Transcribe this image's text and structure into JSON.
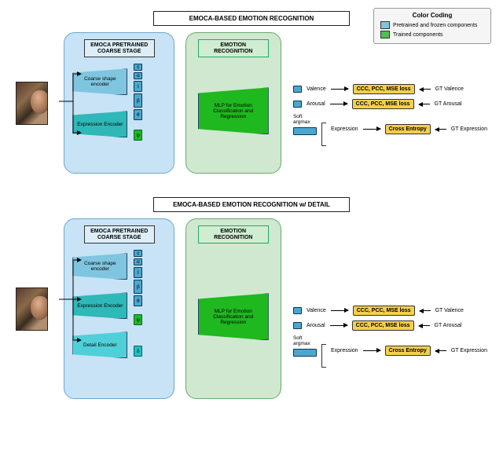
{
  "legend": {
    "title": "Color Coding",
    "pretrained": "Pretrained and frozen components",
    "trained": "Trained components"
  },
  "diagrams": [
    {
      "title": "EMOCA-BASED EMOTION RECOGNITION",
      "coarse_stage_title": "EMOCA PRETRAINED COARSE STAGE",
      "emotion_stage_title": "EMOTION RECOGNITION",
      "encoders": {
        "coarse": "Coarse shape encoder",
        "expression": "Expression Encoder"
      },
      "params": {
        "c": "c",
        "a": "α",
        "l": "l",
        "beta": "β",
        "theta": "θ",
        "psi": "ψ"
      },
      "mlp": "MLP for Emotion Classification and Regression",
      "outputs": {
        "valence": "Valence",
        "arousal": "Arousal",
        "expression": "Expression",
        "softargmax": "Soft argmax"
      },
      "losses": {
        "ccc": "CCC, PCC, MSE loss",
        "ce": "Cross Entropy"
      },
      "gt": {
        "valence": "GT Valence",
        "arousal": "GT Arousal",
        "expression": "GT Expression"
      }
    },
    {
      "title": "EMOCA-BASED EMOTION RECOGNITION w/ DETAIL",
      "coarse_stage_title": "EMOCA PRETRAINED COARSE STAGE",
      "emotion_stage_title": "EMOTION RECOGNITION",
      "encoders": {
        "coarse": "Coarse shape encoder",
        "expression": "Expression Encoder",
        "detail": "Detail Encoder"
      },
      "params": {
        "c": "c",
        "a": "α",
        "l": "l",
        "beta": "β",
        "theta": "θ",
        "psi": "ψ",
        "delta": "δ"
      },
      "mlp": "MLP for Emotion Classification and Regression",
      "outputs": {
        "valence": "Valence",
        "arousal": "Arousal",
        "expression": "Expression",
        "softargmax": "Soft argmax"
      },
      "losses": {
        "ccc": "CCC, PCC, MSE loss",
        "ce": "Cross Entropy"
      },
      "gt": {
        "valence": "GT Valence",
        "arousal": "GT Arousal",
        "expression": "GT Expression"
      }
    }
  ]
}
